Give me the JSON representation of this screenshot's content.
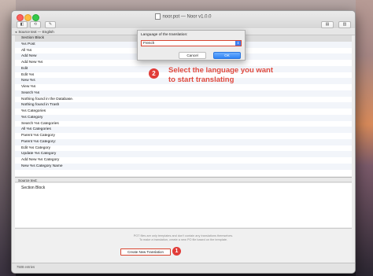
{
  "window": {
    "title": "noor.pot — Noor v1.0.0"
  },
  "toolbar": {
    "buttons": [
      "◧",
      "⟲",
      "✎",
      "▤",
      "▥"
    ]
  },
  "breadcrumb": "Source text — English",
  "list": {
    "rows": [
      "Section Block",
      "%s Post",
      "All %s",
      "Add New",
      "Add New %s",
      "Edit",
      "Edit %s",
      "New %s",
      "View %s",
      "Search %s",
      "Nothing found in the Database.",
      "Nothing found in Trash",
      "%s Categories",
      "%s Category",
      "Search %s Categories",
      "All %s Categories",
      "Parent %s Category",
      "Parent %s Category:",
      "Edit %s Category",
      "Update %s Category",
      "Add New %s Category",
      "New %s Category Name",
      "",
      ""
    ]
  },
  "source": {
    "header": "Source text:",
    "text": "Section Block"
  },
  "empty_pane": {
    "note_line1": "POT files are only templates and don't contain any translations themselves.",
    "note_line2": "To make a translation, create a new PO file based on the template.",
    "create_button": "Create New Translation"
  },
  "status": {
    "entries": "7508 entries"
  },
  "sheet": {
    "label": "Language of the translation:",
    "selected_language": "French",
    "cancel_label": "Cancel",
    "ok_label": "OK"
  },
  "annotations": {
    "marker_1": "1",
    "marker_2": "2",
    "callout_line1": "Select the language you want",
    "callout_line2": "to start translating"
  },
  "colors": {
    "accent_red": "#e13c38",
    "ok_blue": "#2f84f5"
  }
}
